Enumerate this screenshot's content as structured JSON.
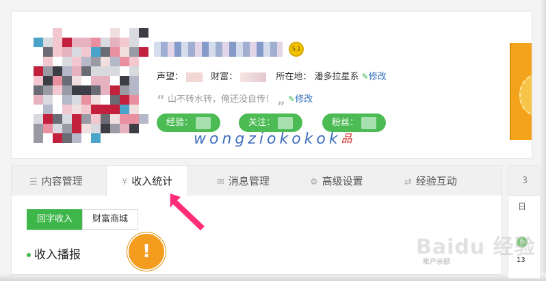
{
  "profile": {
    "level_badge": "5.1",
    "reputation_label": "声望：",
    "wealth_label": "财富：",
    "location_label": "所在地：",
    "location_value": "潘多拉星系",
    "edit_label": "修改",
    "motto_open": "“",
    "motto_text": "山不转水转，俺还没自传！",
    "motto_close": "„",
    "stats": [
      {
        "label": "经验："
      },
      {
        "label": "关注："
      },
      {
        "label": "粉丝："
      }
    ],
    "watermark": "wongziokokok",
    "watermark_logo": "品"
  },
  "tabs": [
    {
      "icon": "list-icon",
      "icon_glyph": "☰",
      "label": "内容管理"
    },
    {
      "icon": "yen-icon",
      "icon_glyph": "¥",
      "label": "收入统计"
    },
    {
      "icon": "mail-icon",
      "icon_glyph": "✉",
      "label": "消息管理"
    },
    {
      "icon": "gear-icon",
      "icon_glyph": "⚙",
      "label": "高级设置"
    },
    {
      "icon": "exchange-icon",
      "icon_glyph": "⇄",
      "label": "经验互动"
    }
  ],
  "active_tab_index": 1,
  "subtabs": [
    {
      "label": "回字收入"
    },
    {
      "label": "财富商城"
    }
  ],
  "section_title": "收入播报",
  "right_panel": {
    "top": "3",
    "day": "日",
    "badge": "6",
    "num": "13"
  },
  "annotation": {
    "warn_glyph": "!"
  },
  "baidu_watermark": {
    "main": "Baidu 经验",
    "sub": "账户余额"
  },
  "colors": {
    "accent_green": "#3fb64a",
    "link_blue": "#2f6fbb",
    "annotation_pink": "#ff2d78",
    "warning_orange": "#f39c1e"
  }
}
